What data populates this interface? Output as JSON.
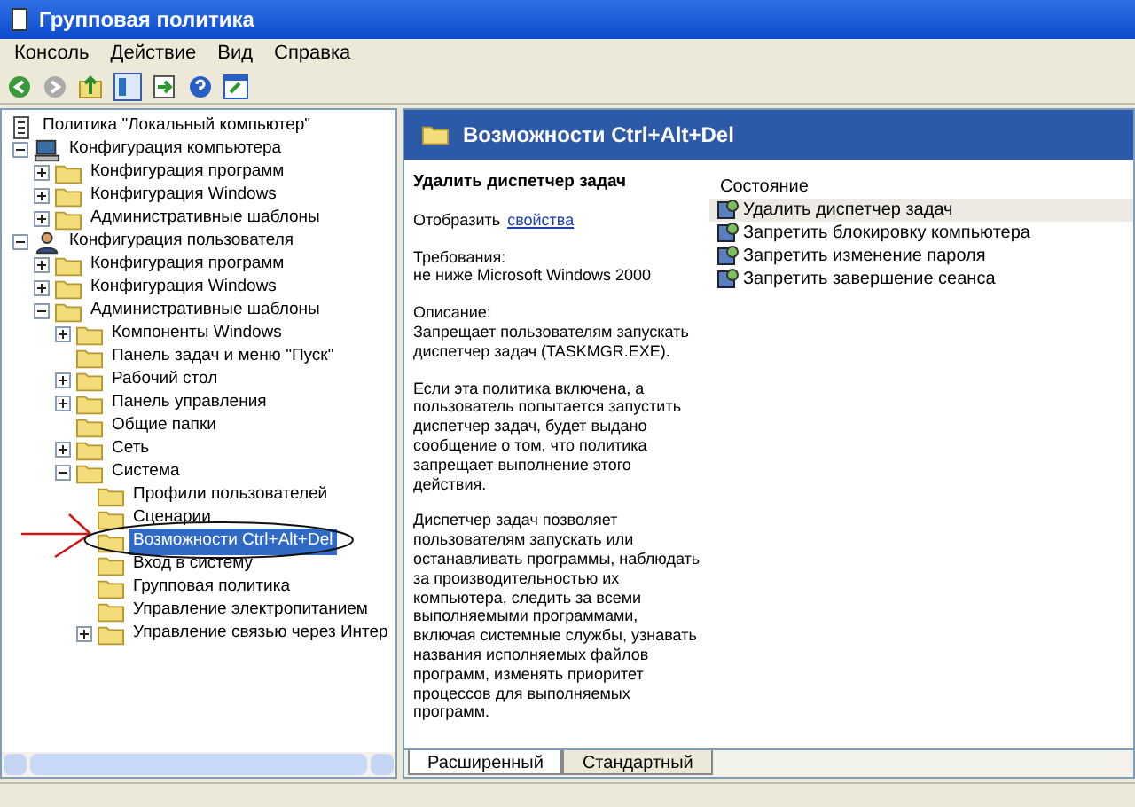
{
  "window": {
    "title": "Групповая политика"
  },
  "menu": [
    "Консоль",
    "Действие",
    "Вид",
    "Справка"
  ],
  "tree": [
    {
      "label": "Политика \"Локальный компьютер\"",
      "kind": "policy",
      "selected": false,
      "children": [
        {
          "label": "Конфигурация компьютера",
          "kind": "computer",
          "expanded": true,
          "selected": false,
          "children": [
            {
              "label": "Конфигурация программ",
              "kind": "folder",
              "expanded": false,
              "selected": false
            },
            {
              "label": "Конфигурация Windows",
              "kind": "folder",
              "expanded": false,
              "selected": false
            },
            {
              "label": "Административные шаблоны",
              "kind": "folder",
              "expanded": false,
              "selected": false
            }
          ]
        },
        {
          "label": "Конфигурация пользователя",
          "kind": "user",
          "expanded": true,
          "selected": false,
          "children": [
            {
              "label": "Конфигурация программ",
              "kind": "folder",
              "expanded": false,
              "selected": false
            },
            {
              "label": "Конфигурация Windows",
              "kind": "folder",
              "expanded": false,
              "selected": false
            },
            {
              "label": "Административные шаблоны",
              "kind": "folder",
              "expanded": true,
              "selected": false,
              "children": [
                {
                  "label": "Компоненты Windows",
                  "kind": "folder",
                  "expanded": false,
                  "selected": false
                },
                {
                  "label": "Панель задач и меню \"Пуск\"",
                  "kind": "folder",
                  "selected": false
                },
                {
                  "label": "Рабочий стол",
                  "kind": "folder",
                  "expanded": false,
                  "selected": false
                },
                {
                  "label": "Панель управления",
                  "kind": "folder",
                  "expanded": false,
                  "selected": false
                },
                {
                  "label": "Общие папки",
                  "kind": "folder",
                  "selected": false
                },
                {
                  "label": "Сеть",
                  "kind": "folder",
                  "expanded": false,
                  "selected": false
                },
                {
                  "label": "Система",
                  "kind": "folder",
                  "expanded": true,
                  "selected": false,
                  "children": [
                    {
                      "label": "Профили пользователей",
                      "kind": "folder",
                      "selected": false
                    },
                    {
                      "label": "Сценарии",
                      "kind": "folder",
                      "selected": false
                    },
                    {
                      "label": "Возможности Ctrl+Alt+Del",
                      "kind": "folder",
                      "selected": true
                    },
                    {
                      "label": "Вход в систему",
                      "kind": "folder",
                      "selected": false
                    },
                    {
                      "label": "Групповая политика",
                      "kind": "folder",
                      "selected": false
                    },
                    {
                      "label": "Управление электропитанием",
                      "kind": "folder",
                      "selected": false
                    },
                    {
                      "label": "Управление связью через Интер",
                      "kind": "folder",
                      "expanded": false,
                      "selected": false
                    }
                  ]
                }
              ]
            }
          ]
        }
      ]
    }
  ],
  "details": {
    "header": "Возможности Ctrl+Alt+Del",
    "setting_title": "Удалить диспетчер задач",
    "show_label": "Отобразить",
    "show_link": "свойства",
    "requirements_label": "Требования:",
    "requirements": "не ниже Microsoft Windows 2000",
    "description_label": "Описание:",
    "paragraphs": [
      "Запрещает пользователям запускать диспетчер задач (TASKMGR.EXE).",
      "Если эта политика включена, а пользователь попытается запустить диспетчер задач, будет выдано сообщение о том, что политика запрещает выполнение этого действия.",
      "Диспетчер задач позволяет пользователям запускать или останавливать программы, наблюдать за производительностью их компьютера, следить за всеми выполняемыми программами, включая системные службы, узнавать названия исполняемых файлов программ, изменять приоритет процессов для выполняемых программ."
    ]
  },
  "list": {
    "column": "Состояние",
    "items": [
      {
        "label": "Удалить диспетчер задач",
        "selected": true
      },
      {
        "label": "Запретить блокировку компьютера",
        "selected": false
      },
      {
        "label": "Запретить изменение пароля",
        "selected": false
      },
      {
        "label": "Запретить завершение сеанса",
        "selected": false
      }
    ]
  },
  "tabs": [
    {
      "label": "Расширенный",
      "selected": true
    },
    {
      "label": "Стандартный",
      "selected": false
    }
  ]
}
